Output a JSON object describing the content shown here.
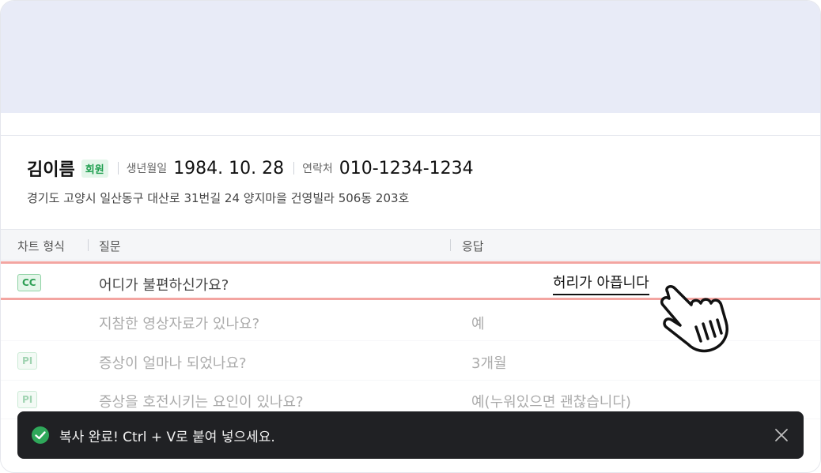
{
  "patient": {
    "name": "김이름",
    "badge": "회원",
    "birth_label": "생년월일",
    "birth_value": "1984. 10. 28",
    "contact_label": "연락처",
    "contact_value": "010-1234-1234",
    "address": "경기도 고양시 일산동구 대산로 31번길 24 양지마을 건영빌라 506동 203호"
  },
  "table": {
    "headers": {
      "type": "차트 형식",
      "question": "질문",
      "answer": "응답"
    },
    "rows": [
      {
        "type": "CC",
        "question": "어디가 불편하신가요?",
        "answer": "허리가 아픕니다"
      },
      {
        "type": "",
        "question": "지참한 영상자료가 있나요?",
        "answer": "예"
      },
      {
        "type": "PI",
        "question": "증상이 얼마나 되었나요?",
        "answer": "3개월"
      },
      {
        "type": "PI",
        "question": "증상을 호전시키는 요인이 있나요?",
        "answer": "예(누워있으면 괜찮습니다)"
      }
    ]
  },
  "toast": {
    "message": "복사 완료! Ctrl + V로 붙여 넣으세요.",
    "icon": "check-circle-icon",
    "close_icon": "close-icon"
  },
  "colors": {
    "accent_green": "#2e9f55",
    "highlight_border": "#f3a5a1",
    "toast_bg": "#202124",
    "top_band": "#e8ebf7"
  }
}
